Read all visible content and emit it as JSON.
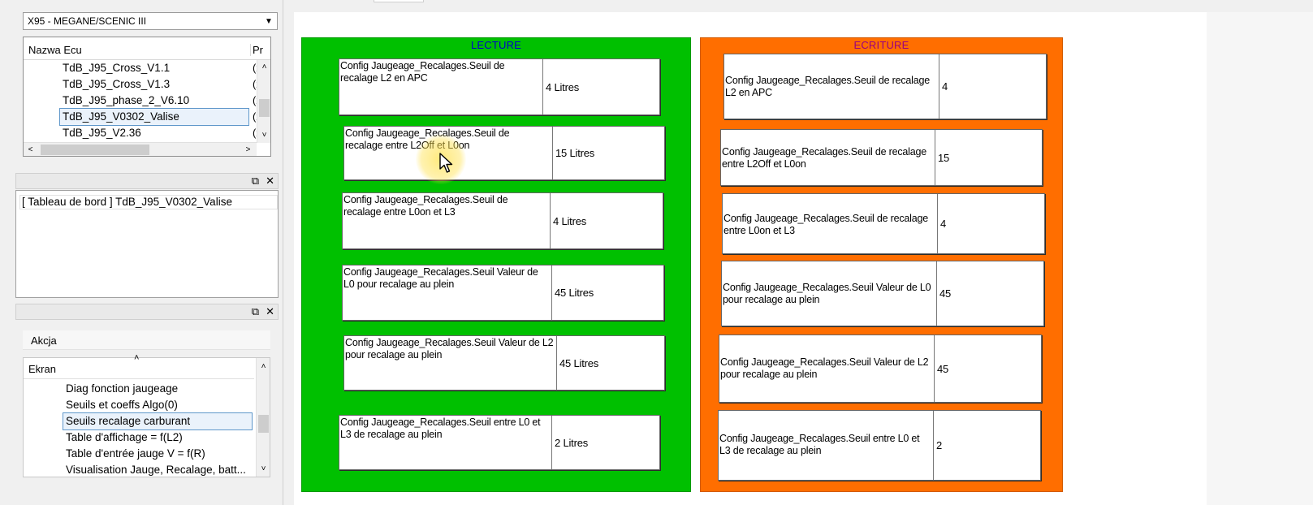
{
  "vehicle_selector": {
    "value": "X95 - MEGANE/SCENIC III"
  },
  "ecu_list": {
    "columns": [
      "Nazwa Ecu",
      "Pr"
    ],
    "rows": [
      {
        "name": "TdB_J95_Cross_V1.1",
        "col2": "(x"
      },
      {
        "name": "TdB_J95_Cross_V1.3",
        "col2": "(x"
      },
      {
        "name": "TdB_J95_phase_2_V6.10",
        "col2": "(x"
      },
      {
        "name": "TdB_J95_V0302_Valise",
        "col2": "(x",
        "selected": true
      },
      {
        "name": "TdB_J95_V2.36",
        "col2": "(x"
      }
    ]
  },
  "info_panel": {
    "line": "[ Tableau de bord ] TdB_J95_V0302_Valise"
  },
  "action_panel": {
    "header": "Akcja",
    "list_header": "Ekran",
    "items": [
      {
        "label": "Diag fonction jaugeage"
      },
      {
        "label": "Seuils et coeffs Algo(0)"
      },
      {
        "label": "Seuils recalage carburant",
        "selected": true
      },
      {
        "label": "Table d'affichage = f(L2)"
      },
      {
        "label": "Table d'entrée jauge V = f(R)"
      },
      {
        "label": "Visualisation Jauge, Recalage, batt..."
      }
    ]
  },
  "icons": {
    "restore": "restore-icon",
    "close": "close-icon"
  },
  "colors": {
    "lecture_bg": "#00c000",
    "ecriture_bg": "#ff6e00",
    "lecture_title": "#0000cc",
    "ecriture_title": "#9a0080"
  },
  "lecture": {
    "title": "LECTURE",
    "fields": [
      {
        "label": "Config Jaugeage_Recalages.Seuil de recalage L2 en APC",
        "value": "4 Litres"
      },
      {
        "label": "Config Jaugeage_Recalages.Seuil de recalage entre L2Off et L0on",
        "value": "15 Litres"
      },
      {
        "label": "Config Jaugeage_Recalages.Seuil de recalage entre L0on et L3",
        "value": "4 Litres"
      },
      {
        "label": "Config Jaugeage_Recalages.Seuil Valeur de L0 pour recalage au plein",
        "value": "45 Litres"
      },
      {
        "label": "Config Jaugeage_Recalages.Seuil Valeur de L2 pour recalage au plein",
        "value": "45 Litres"
      },
      {
        "label": "Config Jaugeage_Recalages.Seuil entre L0 et L3 de recalage au plein",
        "value": "2 Litres"
      }
    ]
  },
  "ecriture": {
    "title": "ECRITURE",
    "fields": [
      {
        "label": "Config Jaugeage_Recalages.Seuil de recalage L2 en APC",
        "value": "4"
      },
      {
        "label": "Config Jaugeage_Recalages.Seuil de recalage entre L2Off et L0on",
        "value": "15"
      },
      {
        "label": "Config Jaugeage_Recalages.Seuil de recalage entre L0on et L3",
        "value": "4"
      },
      {
        "label": "Config Jaugeage_Recalages.Seuil Valeur de L0 pour recalage au plein",
        "value": "45"
      },
      {
        "label": "Config Jaugeage_Recalages.Seuil Valeur de L2 pour recalage au plein",
        "value": "45"
      },
      {
        "label": "Config Jaugeage_Recalages.Seuil entre L0 et L3 de recalage au plein",
        "value": "2"
      }
    ]
  }
}
